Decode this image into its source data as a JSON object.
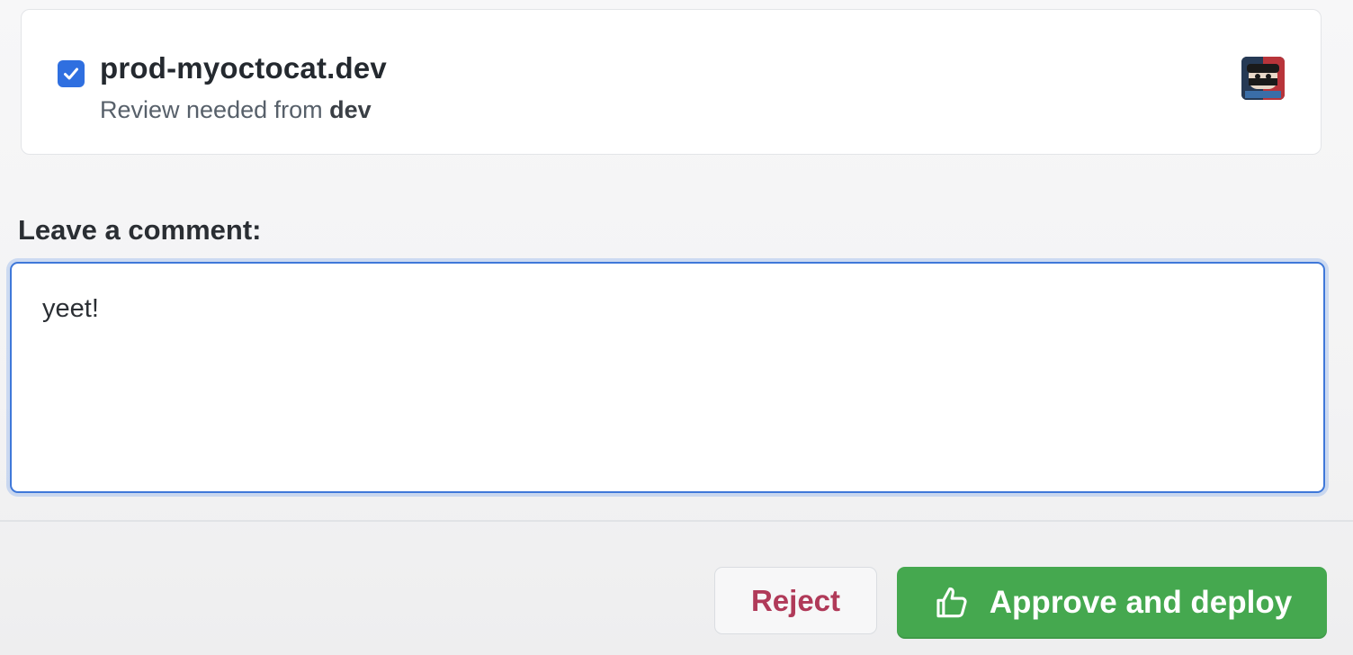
{
  "environment": {
    "checked": true,
    "name": "prod-myoctocat.dev",
    "review_prefix": "Review needed from ",
    "review_team": "dev",
    "avatar_icon": "user-avatar"
  },
  "comment": {
    "label": "Leave a comment:",
    "value": "yeet!"
  },
  "actions": {
    "reject_label": "Reject",
    "approve_label": "Approve and deploy",
    "approve_icon": "thumbs-up-icon",
    "approve_color": "#45a84f",
    "reject_color": "#b03a59",
    "accent_color": "#2f6fe0"
  }
}
